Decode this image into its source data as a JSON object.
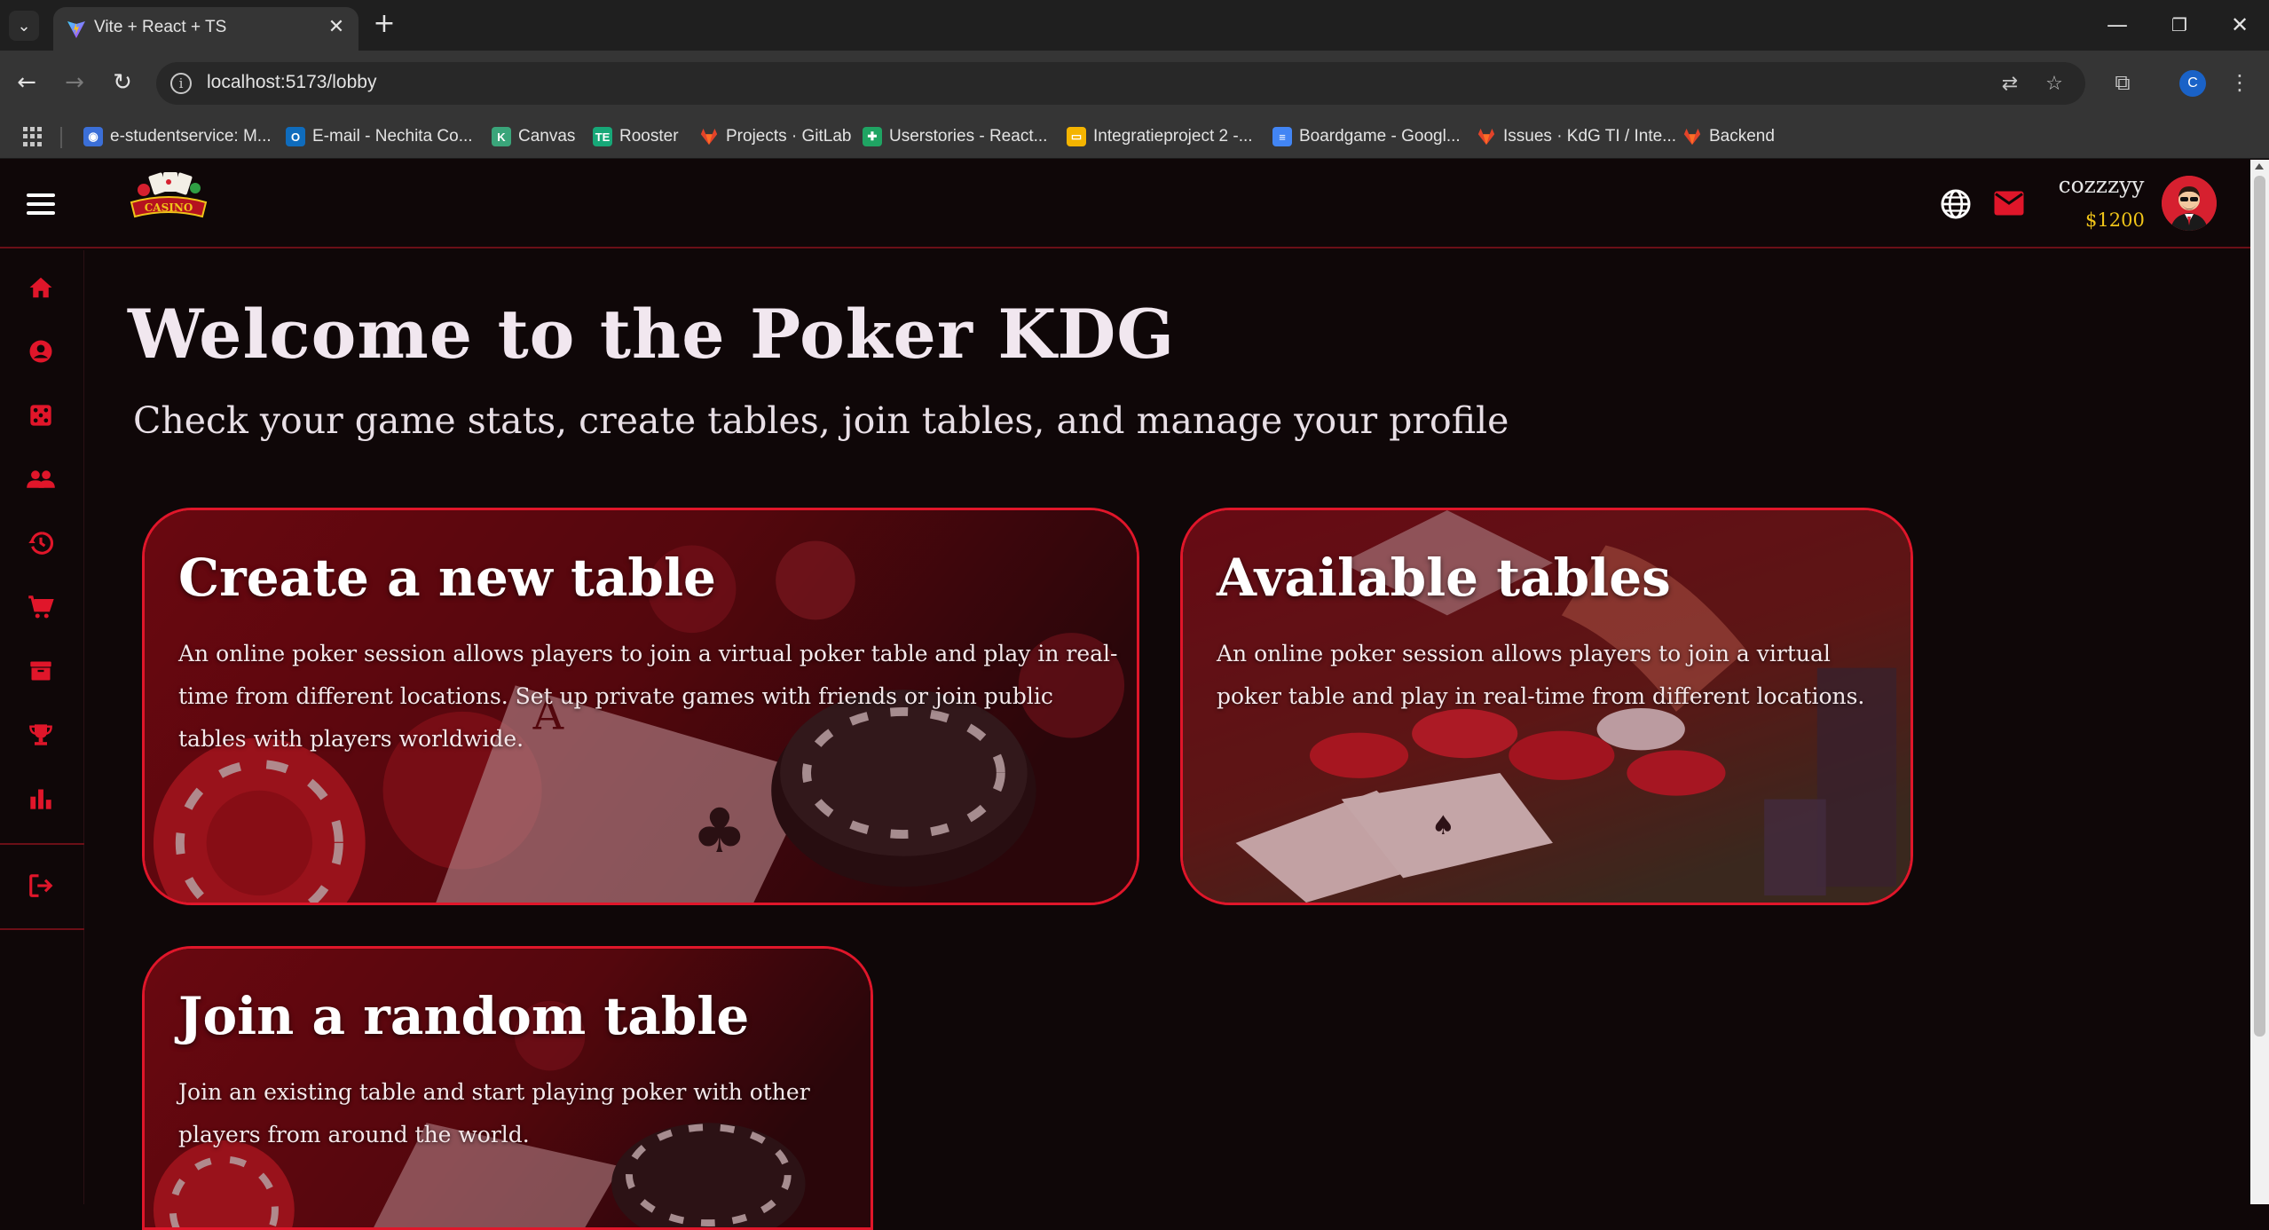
{
  "browser": {
    "tab_title": "Vite + React + TS",
    "url": "localhost:5173/lobby",
    "profile_initial": "C",
    "bookmarks": [
      {
        "label": "e-studentservice: M...",
        "icon": "globe-icon",
        "color": "#3b6fd8"
      },
      {
        "label": "E-mail - Nechita Co...",
        "icon": "outlook-icon",
        "color": "#0f6cbd"
      },
      {
        "label": "Canvas",
        "icon": "canvas-icon",
        "color": "#3aa57a"
      },
      {
        "label": "Rooster",
        "icon": "te-icon",
        "color": "#17a878"
      },
      {
        "label": "Projects · GitLab",
        "icon": "gitlab-icon",
        "color": "#e24329"
      },
      {
        "label": "Userstories - React...",
        "icon": "sheets-icon",
        "color": "#1fa463"
      },
      {
        "label": "Integratieproject 2 -...",
        "icon": "slides-icon",
        "color": "#f4b400"
      },
      {
        "label": "Boardgame - Googl...",
        "icon": "docs-icon",
        "color": "#4285f4"
      },
      {
        "label": "Issues · KdG TI / Inte...",
        "icon": "gitlab-icon",
        "color": "#e24329"
      },
      {
        "label": "Backend",
        "icon": "gitlab-icon",
        "color": "#e24329"
      }
    ]
  },
  "header": {
    "username": "cozzzyy",
    "balance": "$1200",
    "logo_alt": "CASINO"
  },
  "sidebar": {
    "items": [
      {
        "name": "home-icon"
      },
      {
        "name": "profile-icon"
      },
      {
        "name": "dice-icon"
      },
      {
        "name": "friends-icon"
      },
      {
        "name": "history-icon"
      },
      {
        "name": "shop-icon"
      },
      {
        "name": "inventory-icon"
      },
      {
        "name": "trophy-icon"
      },
      {
        "name": "stats-icon"
      }
    ],
    "logout": "logout-icon"
  },
  "main": {
    "title": "Welcome to the Poker KDG",
    "subtitle": "Check your game stats, create tables, join tables, and manage your profile",
    "cards": [
      {
        "title": "Create a new table",
        "description": "An online poker session allows players to join a virtual poker table and play in real-time from different locations. Set up private games with friends or join public tables with players worldwide."
      },
      {
        "title": "Available tables",
        "description": "An online poker session allows players to join a virtual poker table and play in real-time from different locations."
      },
      {
        "title": "Join a random table",
        "description": "Join an existing table and start playing poker with other players from around the world."
      }
    ]
  },
  "colors": {
    "accent": "#e0162a",
    "balance": "#f0c419",
    "background": "#0f0708"
  }
}
